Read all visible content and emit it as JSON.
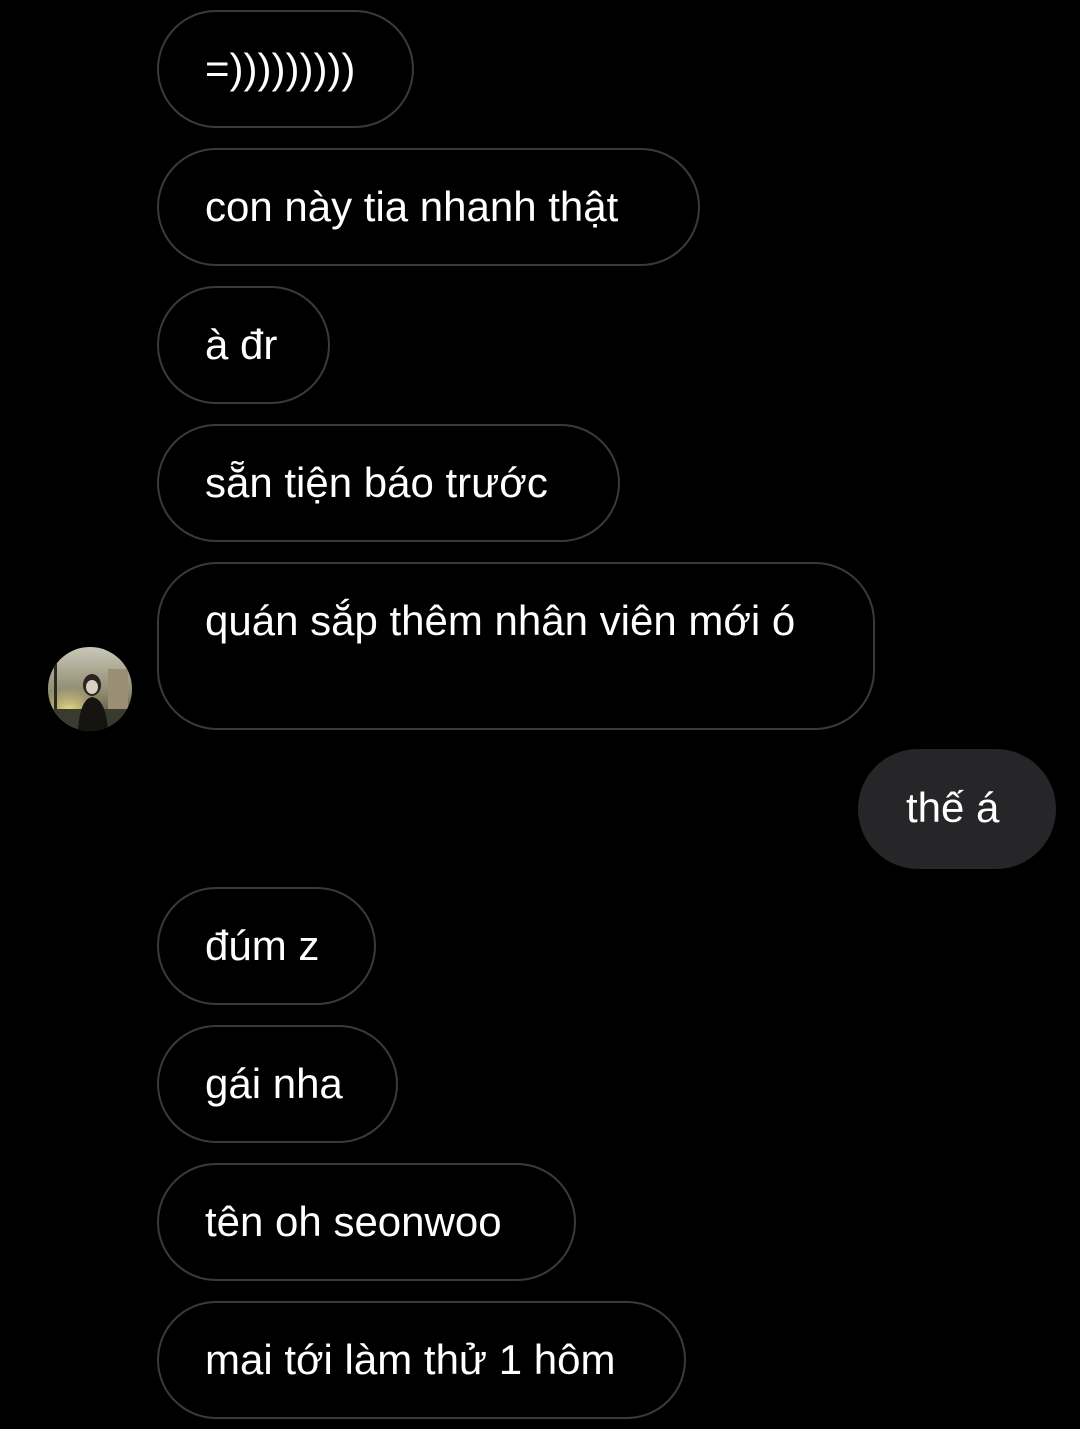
{
  "conversation": {
    "messages": [
      {
        "sender": "them",
        "text": "=)))))))))"
      },
      {
        "sender": "them",
        "text": "con này tia nhanh thật"
      },
      {
        "sender": "them",
        "text": "à đr"
      },
      {
        "sender": "them",
        "text": "sẵn tiện báo trước"
      },
      {
        "sender": "them",
        "text": "quán sắp thêm nhân viên mới ó"
      },
      {
        "sender": "me",
        "text": "thế á"
      },
      {
        "sender": "them",
        "text": "đúm z"
      },
      {
        "sender": "them",
        "text": "gái nha"
      },
      {
        "sender": "them",
        "text": "tên oh seonwoo"
      },
      {
        "sender": "them",
        "text": "mai tới làm thử 1 hôm"
      }
    ]
  },
  "colors": {
    "background": "#000000",
    "incoming_border": "#3a3a3c",
    "outgoing_fill": "#262628",
    "text": "#ffffff"
  },
  "icons": {
    "avatar": "contact-avatar-photo"
  }
}
